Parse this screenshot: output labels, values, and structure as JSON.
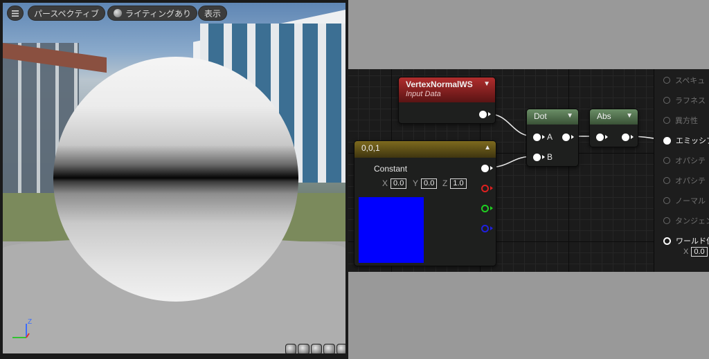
{
  "viewport": {
    "menu_icon": "hamburger-icon",
    "perspective_label": "パースペクティブ",
    "lighting_label": "ライティングあり",
    "show_label": "表示",
    "axis_label": "Z"
  },
  "graph": {
    "vertex_normal": {
      "title": "VertexNormalWS",
      "subtitle": "Input Data"
    },
    "dot": {
      "title": "Dot",
      "pin_a": "A",
      "pin_b": "B"
    },
    "abs": {
      "title": "Abs"
    },
    "constant": {
      "title": "0,0,1",
      "label": "Constant",
      "x_label": "X",
      "x_value": "0.0",
      "y_label": "Y",
      "y_value": "0.0",
      "z_label": "Z",
      "z_value": "1.0",
      "color": "#0000ff"
    },
    "output": {
      "rows": [
        "スペキュ",
        "ラフネス",
        "異方性",
        "エミッシブ",
        "オパシテ",
        "オパシテ",
        "ノーマル",
        "タンジェン",
        "ワールド位"
      ],
      "world_x_label": "X",
      "world_x_value": "0.0"
    }
  },
  "colors": {
    "vertex_header": "#b02d2d",
    "math_header": "#6a8e66",
    "constant_header": "#7d6a1e",
    "pin_red": "#e02020",
    "pin_green": "#20d020",
    "pin_blue": "#2020e0"
  }
}
